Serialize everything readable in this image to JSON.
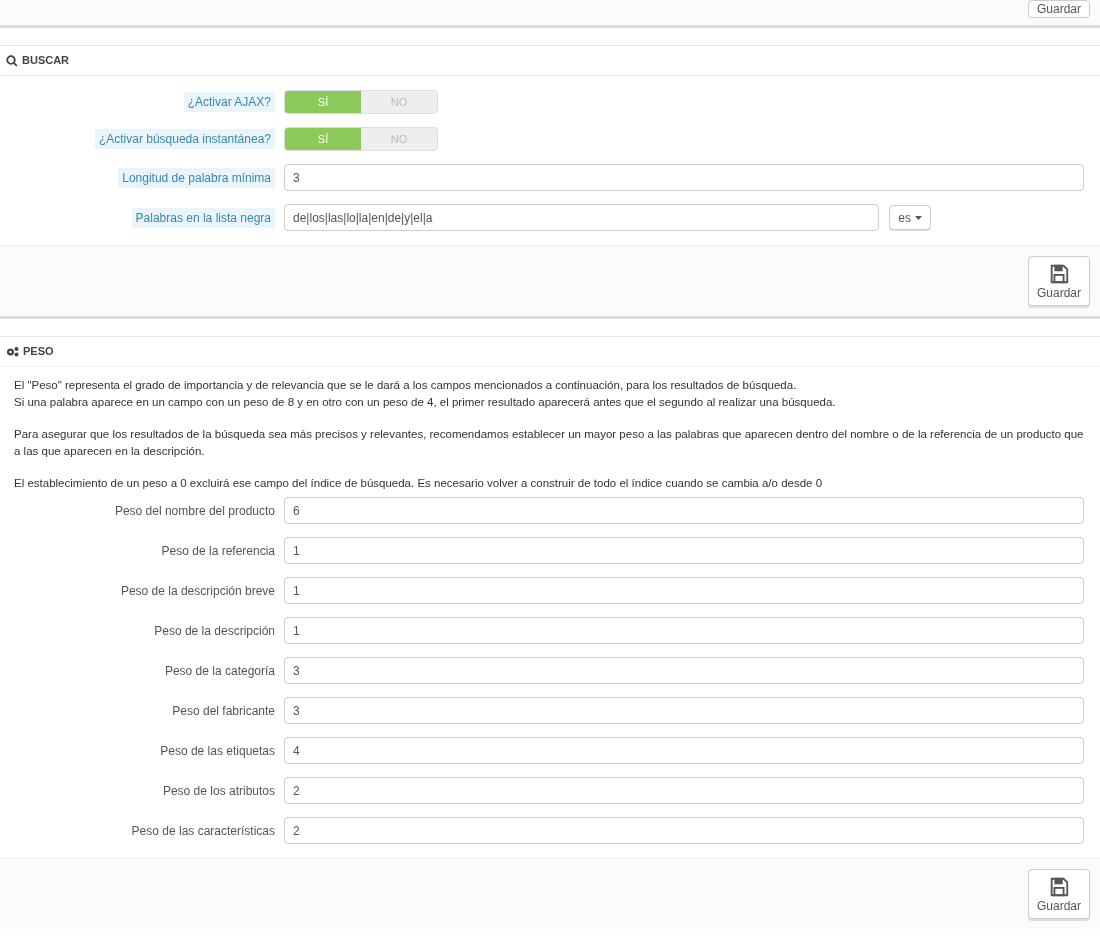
{
  "top_bar": {
    "save_button": "Guardar"
  },
  "search_panel": {
    "title": "BUSCAR",
    "switches": [
      {
        "label": "¿Activar AJAX?",
        "options": [
          {
            "label": "SÍ",
            "selected": true
          },
          {
            "label": "NO",
            "selected": false
          }
        ]
      },
      {
        "label": "¿Activar búsqueda instantánea?",
        "options": [
          {
            "label": "SÍ",
            "selected": true
          },
          {
            "label": "NO",
            "selected": false
          }
        ]
      }
    ],
    "fields": [
      {
        "label": "Longitud de palabra mínima",
        "value": "3"
      },
      {
        "label": "Palabras en la lista negra",
        "value": "de|los|las|lo|la|en|de|y|el|a",
        "language": "es"
      }
    ],
    "save_button": "Guardar"
  },
  "weight_panel": {
    "title": "PESO",
    "paragraphs": [
      [
        "El \"Peso\" representa el grado de importancia y de relevancia que se le dará a los campos mencionados a continuación, para los resultados de búsqueda.",
        "Si una palabra aparece en un campo con un peso de 8 y en otro con un peso de 4, el primer resultado aparecerá antes que el segundo al realizar una búsqueda."
      ],
      [
        "Para asegurar que los resultados de la búsqueda sea más precisos y relevantes, recomendamos establecer un mayor peso a las palabras que aparecen dentro del nombre o de la referencia de un producto que a las que aparecen en la descripción."
      ],
      [
        "El establecimiento de un peso a 0 excluirá ese campo del índice de búsqueda. Es necesario volver a construir de todo el índice cuando se cambia a/o desde 0"
      ]
    ],
    "fields": [
      {
        "label": "Peso del nombre del producto",
        "value": "6"
      },
      {
        "label": "Peso de la referencia",
        "value": "1"
      },
      {
        "label": "Peso de la descripción breve",
        "value": "1"
      },
      {
        "label": "Peso de la descripción",
        "value": "1"
      },
      {
        "label": "Peso de la categoría",
        "value": "3"
      },
      {
        "label": "Peso del fabricante",
        "value": "3"
      },
      {
        "label": "Peso de las etiquetas",
        "value": "4"
      },
      {
        "label": "Peso de los atributos",
        "value": "2"
      },
      {
        "label": "Peso de las características",
        "value": "2"
      }
    ],
    "save_button": "Guardar"
  }
}
